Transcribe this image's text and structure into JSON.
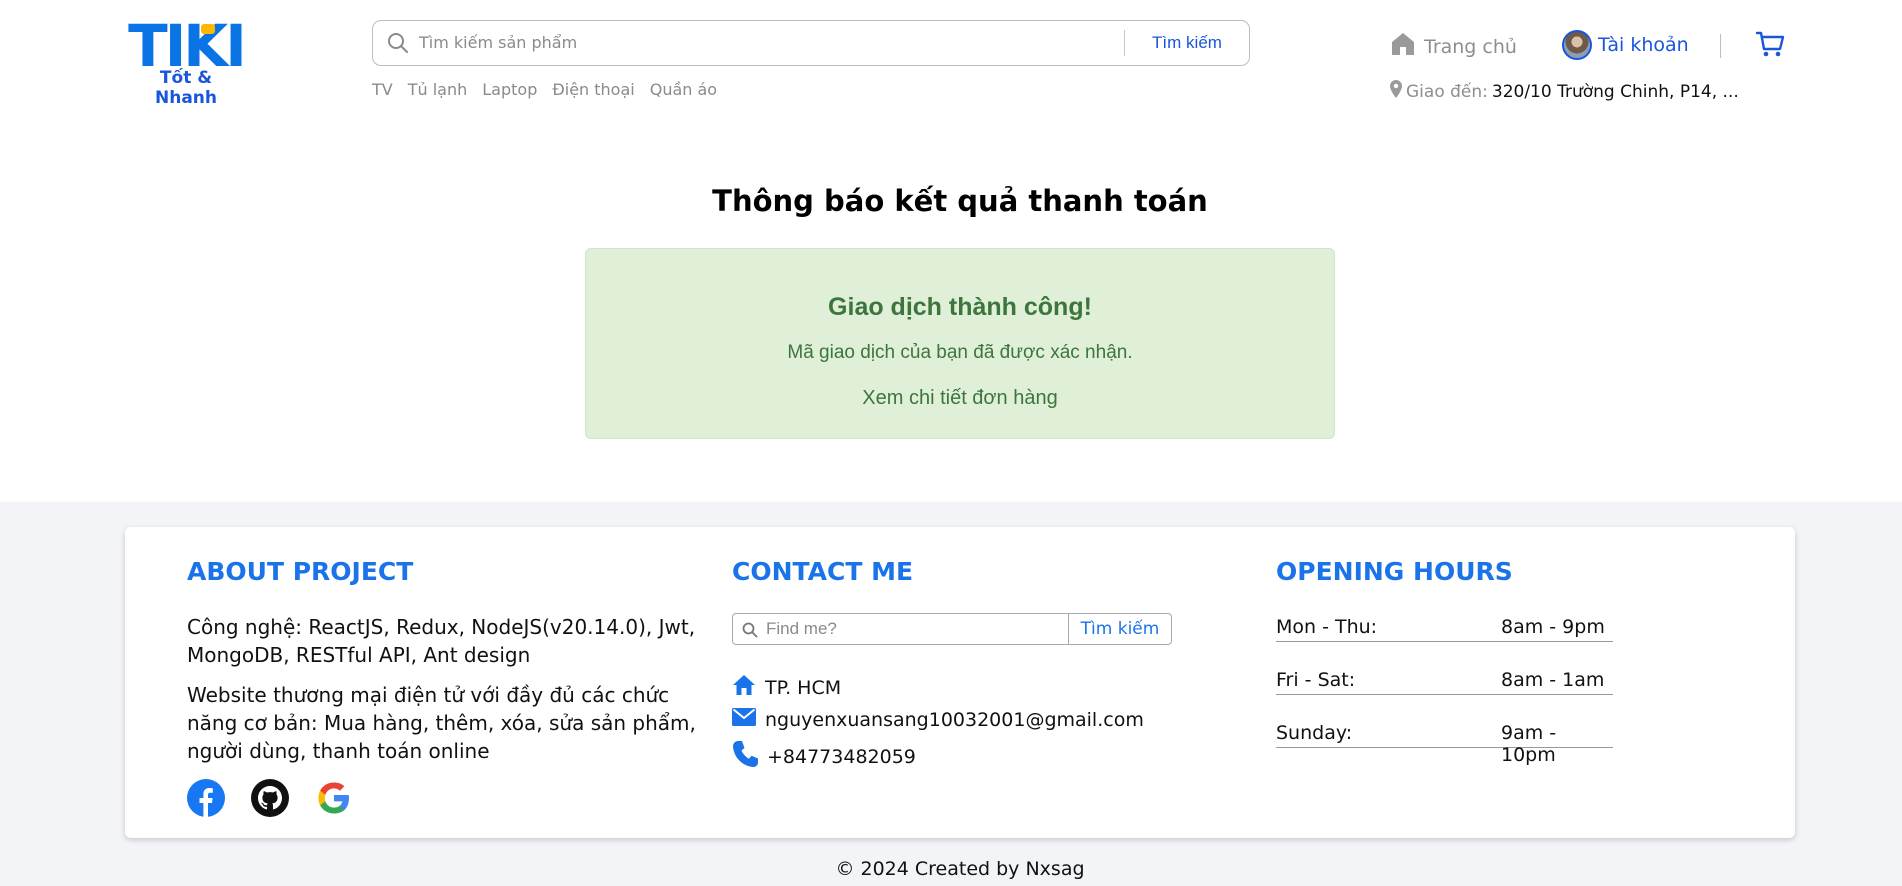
{
  "header": {
    "logo_text": "TIKI",
    "logo_slogan": "Tốt & Nhanh",
    "search": {
      "placeholder": "Tìm kiếm sản phẩm",
      "value": "",
      "button_label": "Tìm kiếm"
    },
    "quick_links": [
      "TV",
      "Tủ lạnh",
      "Laptop",
      "Điện thoại",
      "Quần áo"
    ],
    "home_label": "Trang chủ",
    "account_label": "Tài khoản",
    "delivery_label": "Giao đến:",
    "delivery_address": "320/10 Trường Chinh, P14, ...",
    "colors": {
      "accent": "#1a56db",
      "logo_blue": "#0b74e5",
      "logo_yellow": "#ffb800"
    }
  },
  "main": {
    "title": "Thông báo kết quả thanh toán",
    "result": {
      "title": "Giao dịch thành công!",
      "message": "Mã giao dịch của bạn đã được xác nhận.",
      "link_label": "Xem chi tiết đơn hàng",
      "colors": {
        "background": "#dfefd8",
        "text": "#3c763d"
      }
    }
  },
  "footer": {
    "about": {
      "title": "ABOUT PROJECT",
      "tech": "Công nghệ: ReactJS, Redux, NodeJS(v20.14.0), Jwt, MongoDB, RESTful API, Ant design",
      "description": "Website thương mại điện tử với đầy đủ các chức năng cơ bản: Mua hàng, thêm, xóa, sửa sản phẩm, người dùng, thanh toán online",
      "social_icons": [
        "facebook-icon",
        "github-icon",
        "google-icon"
      ]
    },
    "contact": {
      "title": "CONTACT ME",
      "search_placeholder": "Find me?",
      "search_button": "Tìm kiếm",
      "city": "TP. HCM",
      "email": "nguyenxuansang10032001@gmail.com",
      "phone": "+84773482059"
    },
    "hours": {
      "title": "OPENING HOURS",
      "rows": [
        {
          "day": "Mon - Thu:",
          "time": "8am - 9pm"
        },
        {
          "day": "Fri - Sat:",
          "time": "8am - 1am"
        },
        {
          "day": "Sunday:",
          "time": "9am - 10pm"
        }
      ]
    },
    "copyright": "© 2024 Created by Nxsag"
  }
}
